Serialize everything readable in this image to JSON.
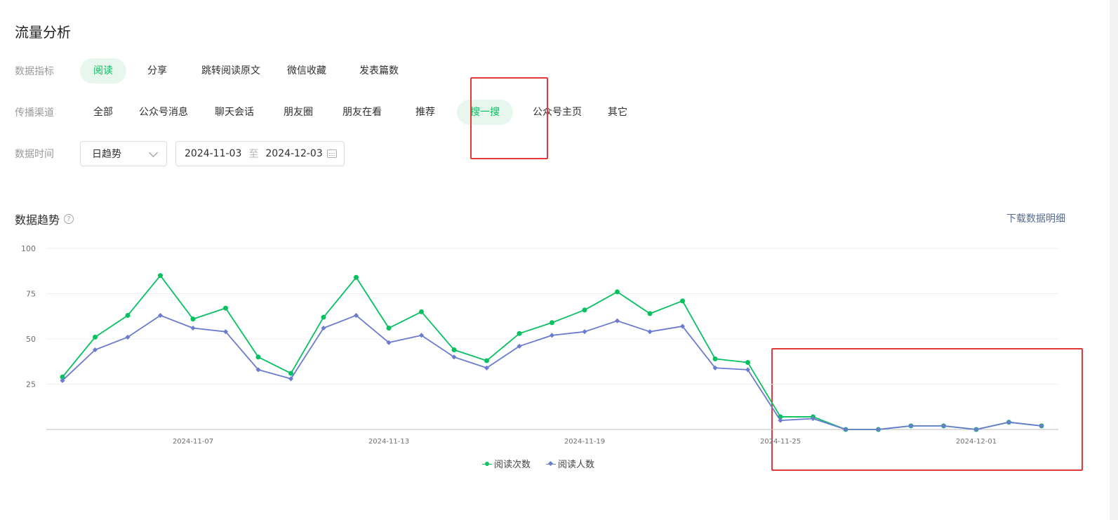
{
  "page_title": "流量分析",
  "metrics": {
    "label": "数据指标",
    "options": [
      "阅读",
      "分享",
      "跳转阅读原文",
      "微信收藏",
      "发表篇数"
    ],
    "selected": 0
  },
  "channels": {
    "label": "传播渠道",
    "options": [
      "全部",
      "公众号消息",
      "聊天会话",
      "朋友圈",
      "朋友在看",
      "推荐",
      "搜一搜",
      "公众号主页",
      "其它"
    ],
    "selected": 6
  },
  "time": {
    "label": "数据时间",
    "mode": "日趋势",
    "start_date": "2024-11-03",
    "separator": "至",
    "end_date": "2024-12-03"
  },
  "section": {
    "title": "数据趋势",
    "help": "?",
    "download_label": "下载数据明细"
  },
  "colors": {
    "accent": "#07c160",
    "series2": "#6b7bd0",
    "highlight_box": "#e23a3a",
    "link": "#576b95"
  },
  "chart_data": {
    "type": "line",
    "x": [
      "2024-11-03",
      "2024-11-04",
      "2024-11-05",
      "2024-11-06",
      "2024-11-07",
      "2024-11-08",
      "2024-11-09",
      "2024-11-10",
      "2024-11-11",
      "2024-11-12",
      "2024-11-13",
      "2024-11-14",
      "2024-11-15",
      "2024-11-16",
      "2024-11-17",
      "2024-11-18",
      "2024-11-19",
      "2024-11-20",
      "2024-11-21",
      "2024-11-22",
      "2024-11-23",
      "2024-11-24",
      "2024-11-25",
      "2024-11-26",
      "2024-11-27",
      "2024-11-28",
      "2024-11-29",
      "2024-11-30",
      "2024-12-01",
      "2024-12-02",
      "2024-12-03"
    ],
    "x_tick_labels": [
      "2024-11-07",
      "2024-11-13",
      "2024-11-19",
      "2024-11-25",
      "2024-12-01"
    ],
    "y_ticks": [
      25,
      50,
      75,
      100
    ],
    "ylim": [
      0,
      100
    ],
    "series": [
      {
        "name": "阅读次数",
        "color": "#07c160",
        "marker": "circle",
        "values": [
          29,
          51,
          63,
          85,
          61,
          67,
          40,
          31,
          62,
          84,
          56,
          65,
          44,
          38,
          53,
          59,
          66,
          76,
          64,
          71,
          39,
          37,
          7,
          7,
          0,
          0,
          2,
          2,
          0,
          4,
          2
        ]
      },
      {
        "name": "阅读人数",
        "color": "#6b7bd0",
        "marker": "diamond",
        "values": [
          27,
          44,
          51,
          63,
          56,
          54,
          33,
          28,
          56,
          63,
          48,
          52,
          40,
          34,
          46,
          52,
          54,
          60,
          54,
          57,
          34,
          33,
          5,
          6,
          0,
          0,
          2,
          2,
          0,
          4,
          2
        ]
      }
    ],
    "legend_position": "bottom-center",
    "grid": true
  }
}
